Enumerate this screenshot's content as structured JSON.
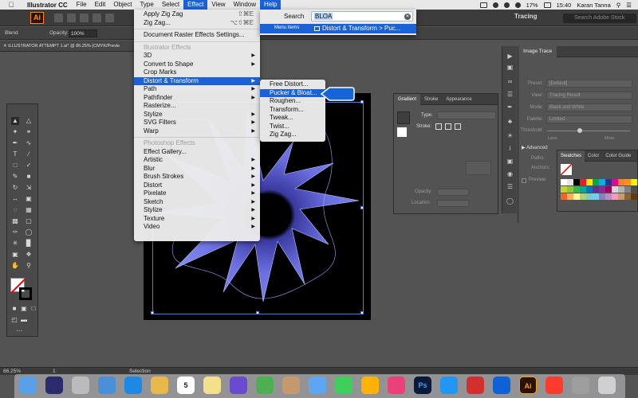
{
  "menubar": {
    "app_name": "Illustrator CC",
    "items": [
      "File",
      "Edit",
      "Object",
      "Type",
      "Select",
      "Effect",
      "View",
      "Window",
      "Help"
    ],
    "battery": "17%",
    "time": "15:40",
    "user": "Karan Tanna"
  },
  "appbar": {
    "logo": "Ai",
    "workspace": "Tracing",
    "search_placeholder": "Search Adobe Stock"
  },
  "controlbar": {
    "blend": "Blend",
    "opacity_label": "Opacity:",
    "opacity_value": "100%"
  },
  "document": {
    "tab_title": "ILLUSTRATOR ATTEMPT 1.ai* @ 86.25% (CMYK/Previe"
  },
  "help": {
    "search_label": "Search",
    "search_value": "BLOA",
    "result_label": "Menu Items",
    "result_text": "Distort & Transform > Puc..."
  },
  "effect_menu": {
    "apply_last": {
      "label": "Apply Zig Zag",
      "shortcut": "⇧⌘E"
    },
    "last_effect": {
      "label": "Zig Zag...",
      "shortcut": "⌥⇧⌘E"
    },
    "document_raster": "Document Raster Effects Settings...",
    "illustrator_header": "Illustrator Effects",
    "illustrator_items": [
      "3D",
      "Convert to Shape",
      "Crop Marks",
      "Distort & Transform",
      "Path",
      "Pathfinder",
      "Rasterize...",
      "Stylize",
      "SVG Filters",
      "Warp"
    ],
    "photoshop_header": "Photoshop Effects",
    "photoshop_items": [
      "Effect Gallery...",
      "Artistic",
      "Blur",
      "Brush Strokes",
      "Distort",
      "Pixelate",
      "Sketch",
      "Stylize",
      "Texture",
      "Video"
    ]
  },
  "distort_menu": {
    "items": [
      "Free Distort...",
      "Pucker & Bloat...",
      "Roughen...",
      "Transform...",
      "Tweak...",
      "Twist...",
      "Zig Zag..."
    ]
  },
  "image_trace": {
    "tab": "Image Trace",
    "preset_label": "Preset:",
    "preset_value": "[Default]",
    "view_label": "View:",
    "view_value": "Tracing Result",
    "mode_label": "Mode:",
    "mode_value": "Black and White",
    "palette_label": "Palette:",
    "palette_value": "Limited",
    "threshold_label": "Threshold:",
    "less": "Less",
    "more": "More",
    "advanced": "Advanced",
    "paths_label": "Paths:",
    "anchors_label": "Anchors:",
    "preview": "Preview"
  },
  "gradient_panel": {
    "tabs": [
      "Gradient",
      "Stroke",
      "Appearance"
    ],
    "type_label": "Type:",
    "stroke_label": "Stroke:",
    "opacity_label": "Opacity",
    "location_label": "Location"
  },
  "swatches_panel": {
    "tabs": [
      "Swatches",
      "Color",
      "Color Guide"
    ],
    "colors": [
      "#ffffff",
      "#e6e6e6",
      "#000000",
      "#ed1c24",
      "#ffe600",
      "#00a651",
      "#00aeef",
      "#2e3192",
      "#ec008c",
      "#ff7f27",
      "#f7941d",
      "#fff200",
      "#c0d72f",
      "#8dc63f",
      "#39b54a",
      "#00a99d",
      "#0072bc",
      "#662d91",
      "#92278f",
      "#9e005d",
      "#d8d8d8",
      "#b3b3b3",
      "#808080",
      "#4d4d4d",
      "#f26522",
      "#fbaf5d",
      "#fff799",
      "#acd373",
      "#7accc8",
      "#6dcff6",
      "#8781bd",
      "#bd8cbf",
      "#f49ac1",
      "#c69c6d",
      "#8c6239",
      "#603913"
    ]
  },
  "statusbar": {
    "zoom": "86.25%",
    "artboard": "1",
    "tool": "Selection"
  },
  "dock": {
    "icons": [
      "finder",
      "siri",
      "rocket",
      "preview",
      "safari",
      "photos-app",
      "calendar",
      "notes",
      "imovie",
      "chrome",
      "contacts",
      "mail",
      "messages",
      "photos",
      "itunes",
      "photoshop",
      "appstore",
      "acrobat",
      "sync",
      "illustrator",
      "pinterest",
      "script",
      "trash"
    ],
    "calendar_day": "5",
    "photoshop_label": "Ps",
    "illustrator_label": "Ai"
  }
}
